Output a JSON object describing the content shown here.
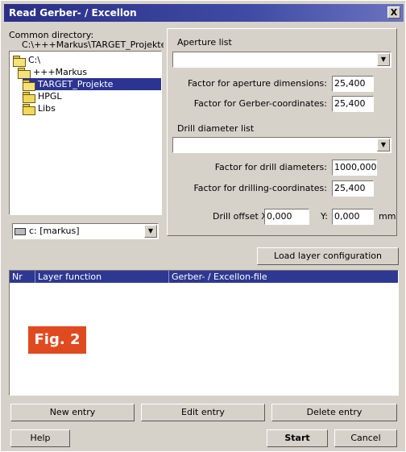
{
  "window": {
    "title": "Read Gerber- / Excellon",
    "close_glyph": "X"
  },
  "directory": {
    "label": "Common directory:",
    "path": "C:\\+++Markus\\TARGET_Projekte",
    "tree": [
      {
        "label": "C:\\",
        "level": 0,
        "selected": false
      },
      {
        "label": "+++Markus",
        "level": 1,
        "selected": false
      },
      {
        "label": "TARGET_Projekte",
        "level": 2,
        "selected": true
      },
      {
        "label": "HPGL",
        "level": 2,
        "selected": false
      },
      {
        "label": "Libs",
        "level": 2,
        "selected": false
      }
    ],
    "drive": "c: [markus]"
  },
  "aperture": {
    "group_label": "Aperture list",
    "combo_value": "",
    "factor_dimensions_label": "Factor for aperture dimensions:",
    "factor_dimensions_value": "25,400",
    "factor_gerber_label": "Factor for Gerber-coordinates:",
    "factor_gerber_value": "25,400"
  },
  "drill": {
    "group_label": "Drill diameter list",
    "combo_value": "",
    "factor_diameters_label": "Factor for drill diameters:",
    "factor_diameters_value": "1000,000",
    "factor_coordinates_label": "Factor for drilling-coordinates:",
    "factor_coordinates_value": "25,400",
    "offset_x_label": "Drill offset X:",
    "offset_x_value": "0,000",
    "offset_y_label": "Y:",
    "offset_y_value": "0,000",
    "unit": "mm"
  },
  "layers": {
    "load_button": "Load layer configuration",
    "columns": [
      "Nr",
      "Layer function",
      "Gerber- / Excellon-file"
    ],
    "rows": []
  },
  "actions": {
    "new_entry": "New entry",
    "edit_entry": "Edit entry",
    "delete_entry": "Delete entry",
    "help": "Help",
    "start": "Start",
    "cancel": "Cancel"
  },
  "badge": "Fig. 2"
}
